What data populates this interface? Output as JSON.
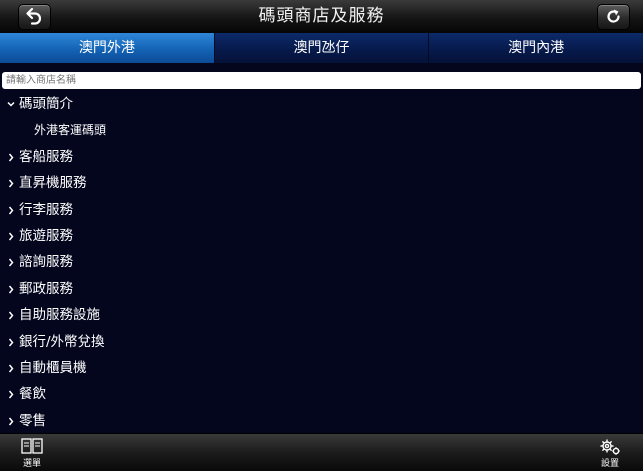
{
  "header": {
    "title": "碼頭商店及服務",
    "back_icon": "back-arrow-icon",
    "refresh_icon": "refresh-icon"
  },
  "tabs": [
    {
      "label": "澳門外港",
      "active": true
    },
    {
      "label": "澳門氹仔",
      "active": false
    },
    {
      "label": "澳門內港",
      "active": false
    }
  ],
  "search": {
    "placeholder": "請輸入商店名稱",
    "value": ""
  },
  "list": [
    {
      "label": "碼頭簡介",
      "expanded": true
    },
    {
      "label": "外港客運碼頭",
      "sub": true
    },
    {
      "label": "客船服務"
    },
    {
      "label": "直昇機服務"
    },
    {
      "label": "行李服務"
    },
    {
      "label": "旅遊服務"
    },
    {
      "label": "諮詢服務"
    },
    {
      "label": "郵政服務"
    },
    {
      "label": "自助服務設施"
    },
    {
      "label": "銀行/外幣兌換"
    },
    {
      "label": "自動櫃員機"
    },
    {
      "label": "餐飲"
    },
    {
      "label": "零售"
    }
  ],
  "toolbar": {
    "menu_label": "選單",
    "menu_icon": "menu-icon",
    "settings_label": "設置",
    "settings_icon": "gear-icon"
  },
  "colors": {
    "background": "#04061e",
    "tab_active": "#1e6fc4",
    "tab_inactive": "#0a2260"
  }
}
